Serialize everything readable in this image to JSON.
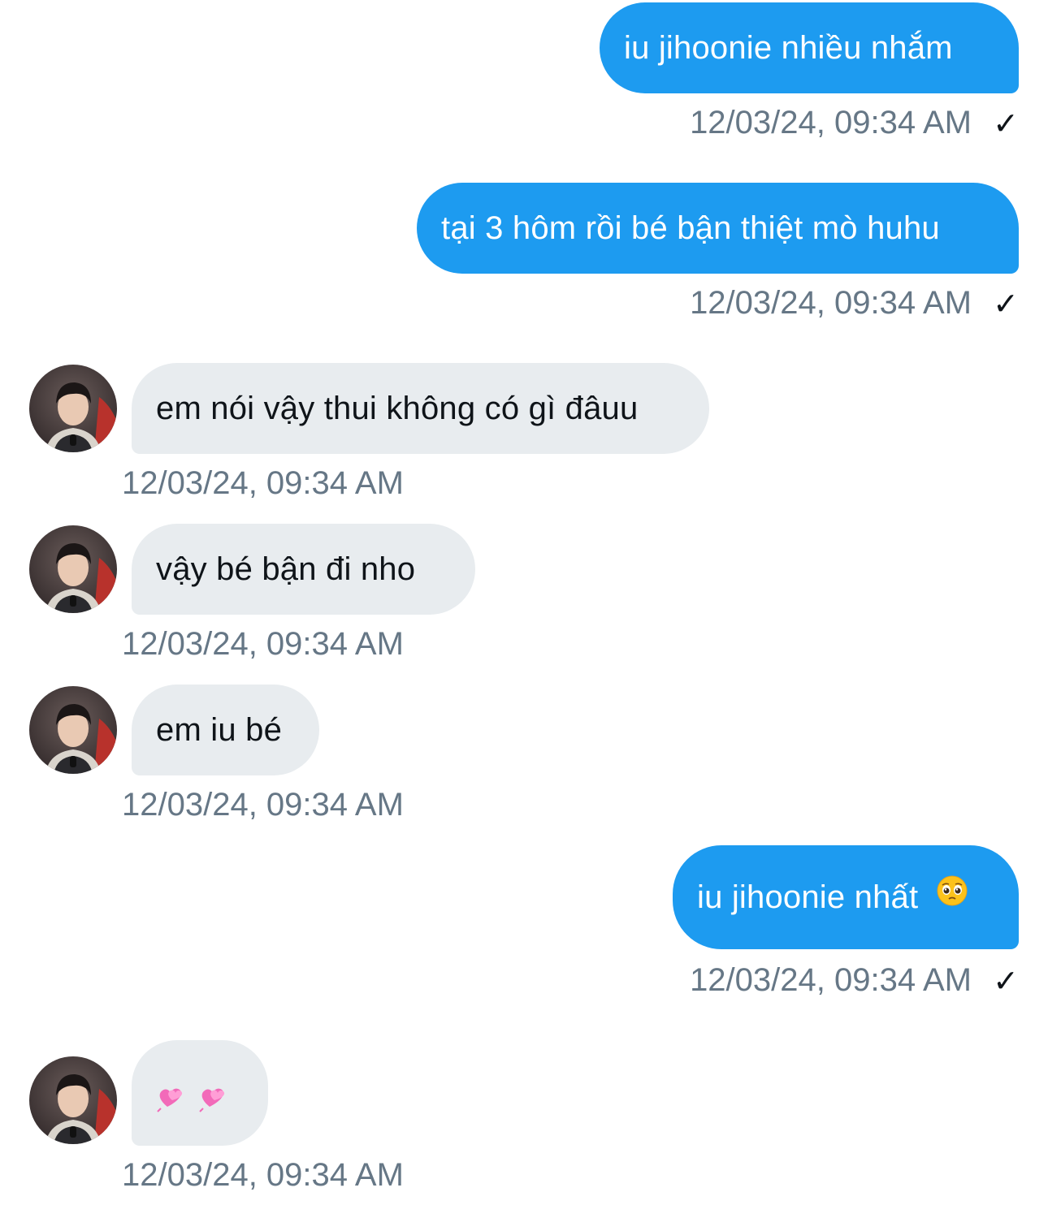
{
  "conversation": {
    "messages": [
      {
        "side": "sent",
        "text": "iu jihoonie nhiều nhắm",
        "time": "12/03/24, 09:34 AM",
        "status": "✓"
      },
      {
        "side": "sent",
        "text": "tại 3 hôm rồi bé bận thiệt mò huhu",
        "time": "12/03/24, 09:34 AM",
        "status": "✓"
      },
      {
        "side": "received",
        "text": "em nói vậy thui không có gì đâuu",
        "time": "12/03/24, 09:34 AM"
      },
      {
        "side": "received",
        "text": "vậy bé bận đi nho",
        "time": "12/03/24, 09:34 AM"
      },
      {
        "side": "received",
        "text": "em iu bé",
        "time": "12/03/24, 09:34 AM"
      },
      {
        "side": "sent",
        "text": "iu jihoonie nhất",
        "emoji": "pleading-face",
        "time": "12/03/24, 09:34 AM",
        "status": "✓"
      },
      {
        "side": "received",
        "text": "💞 💞",
        "emoji": "two-hearts",
        "time": "12/03/24, 09:34 AM"
      }
    ]
  },
  "colors": {
    "sent_bubble": "#1d9bf0",
    "received_bubble": "#e8ecef",
    "timestamp": "#667786"
  }
}
